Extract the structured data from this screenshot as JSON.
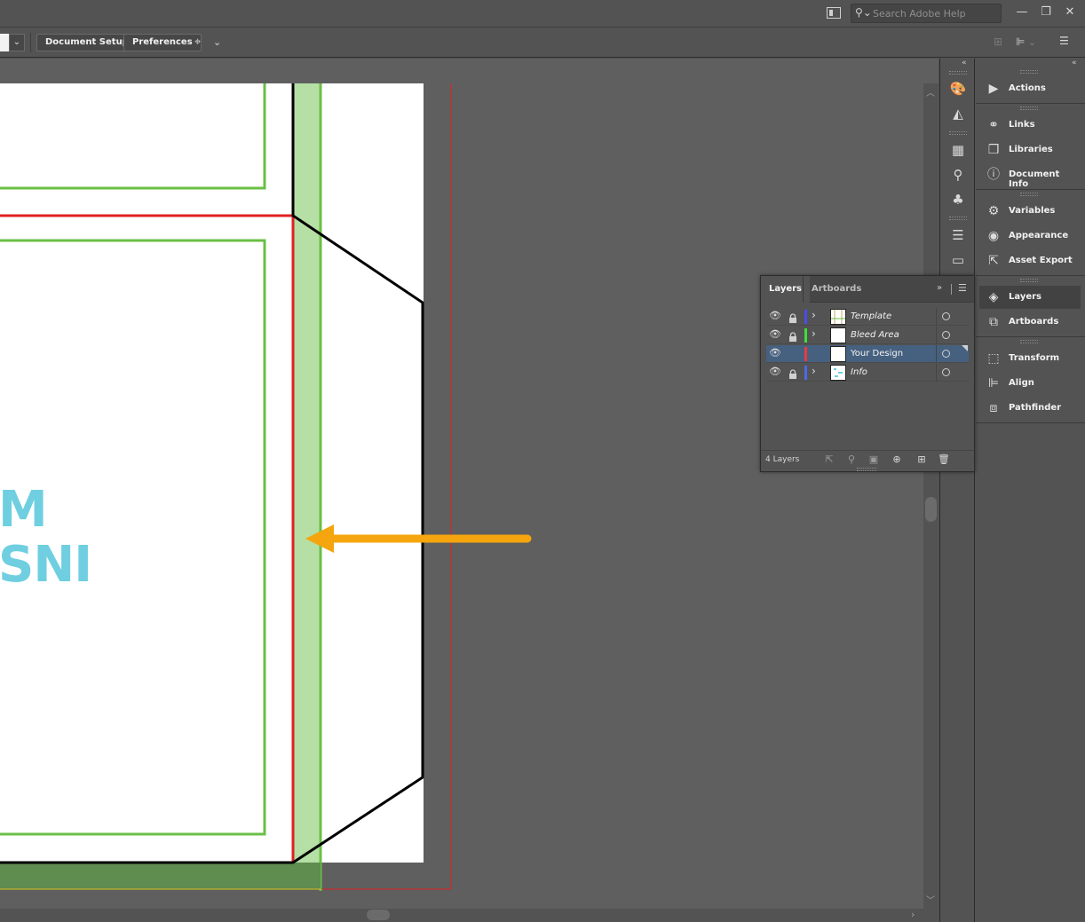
{
  "titlebar": {
    "search_placeholder": "Search Adobe Help",
    "minimize_glyph": "—",
    "restore_glyph": "❐",
    "close_glyph": "✕"
  },
  "controlbar": {
    "document_setup_label": "Document Setup",
    "preferences_label": "Preferences"
  },
  "canvas": {
    "artwork_text_line1": "M",
    "artwork_text_line2": "SNI",
    "artwork_text_color": "#6fcfe0",
    "arrow_color": "#f5a50d",
    "bleed_green": "#6abf45",
    "safe_red": "#e02020"
  },
  "dock": {
    "panels": [
      {
        "label": "Actions",
        "icon": "play-icon"
      },
      {
        "label": "Links",
        "icon": "link-icon"
      },
      {
        "label": "Libraries",
        "icon": "libraries-icon"
      },
      {
        "label": "Document Info",
        "icon": "info-icon"
      },
      {
        "label": "Variables",
        "icon": "variables-icon"
      },
      {
        "label": "Appearance",
        "icon": "appearance-icon"
      },
      {
        "label": "Asset Export",
        "icon": "export-icon"
      },
      {
        "label": "Layers",
        "icon": "layers-icon"
      },
      {
        "label": "Artboards",
        "icon": "artboards-icon"
      },
      {
        "label": "Transform",
        "icon": "transform-icon"
      },
      {
        "label": "Align",
        "icon": "align-icon"
      },
      {
        "label": "Pathfinder",
        "icon": "pathfinder-icon"
      }
    ]
  },
  "layers_panel": {
    "tabs": [
      "Layers",
      "Artboards"
    ],
    "layers": [
      {
        "name": "Template",
        "color": "#4a4de8",
        "locked": true,
        "expandable": true
      },
      {
        "name": "Bleed Area",
        "color": "#3ce03c",
        "locked": true,
        "expandable": true
      },
      {
        "name": "Your Design",
        "color": "#e83c3c",
        "locked": false,
        "expandable": false
      },
      {
        "name": "Info",
        "color": "#4a6ae8",
        "locked": true,
        "expandable": true
      }
    ],
    "count_label": "4 Layers"
  }
}
